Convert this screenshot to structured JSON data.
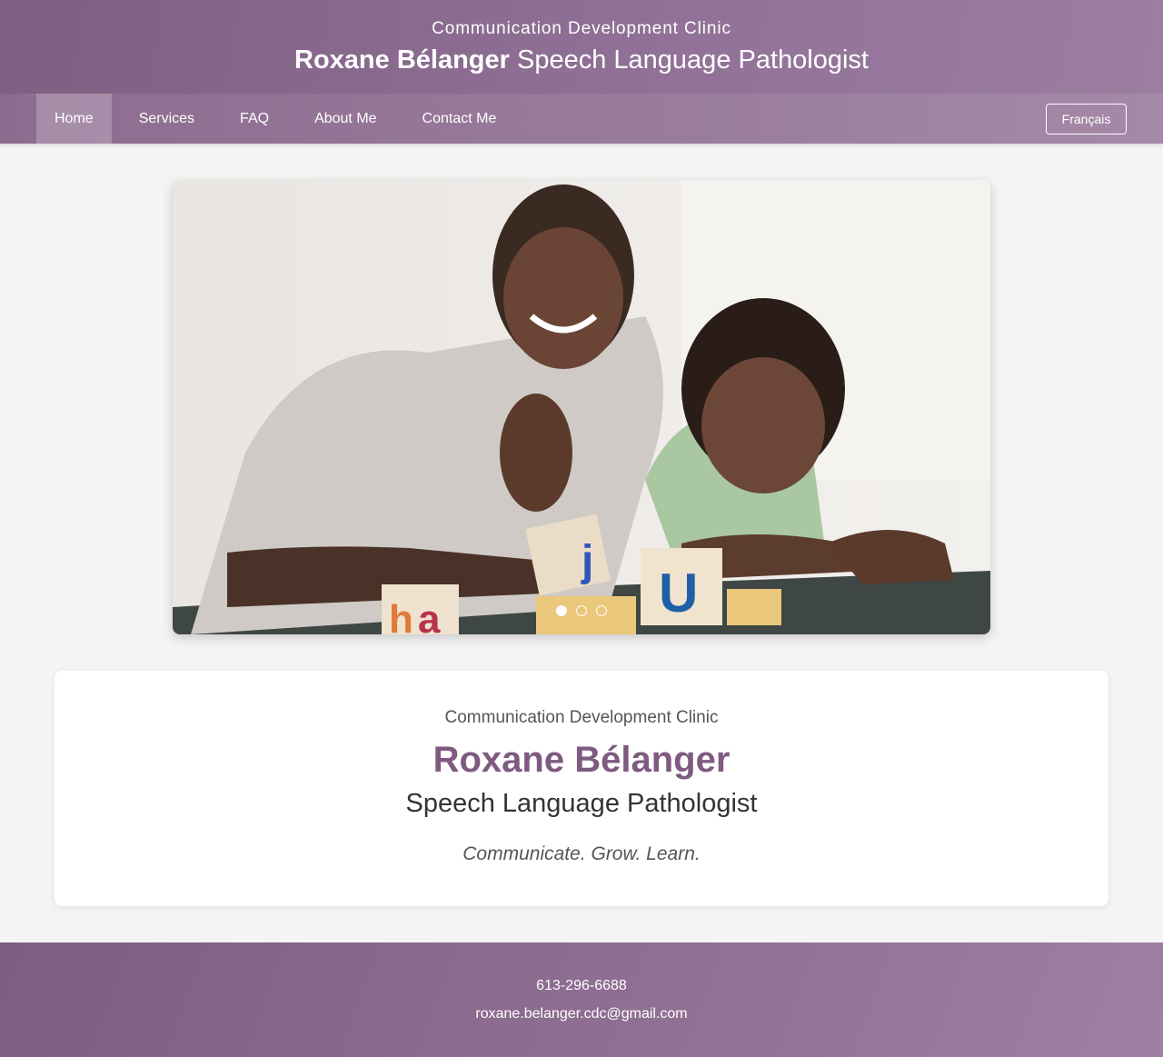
{
  "header": {
    "subtitle": "Communication Development Clinic",
    "name": "Roxane Bélanger",
    "role": "Speech Language Pathologist"
  },
  "nav": {
    "items": [
      {
        "label": "Home",
        "active": true
      },
      {
        "label": "Services",
        "active": false
      },
      {
        "label": "FAQ",
        "active": false
      },
      {
        "label": "About Me",
        "active": false
      },
      {
        "label": "Contact Me",
        "active": false
      }
    ],
    "language_button": "Français"
  },
  "carousel": {
    "slide_count": 3,
    "active_slide": 1
  },
  "intro": {
    "subtitle": "Communication Development Clinic",
    "name": "Roxane Bélanger",
    "role": "Speech Language Pathologist",
    "tagline": "Communicate. Grow. Learn."
  },
  "footer": {
    "phone": "613-296-6688",
    "email": "roxane.belanger.cdc@gmail.com"
  },
  "colors": {
    "brand": "#8d6c8f",
    "accent_name": "#7e5a80"
  }
}
